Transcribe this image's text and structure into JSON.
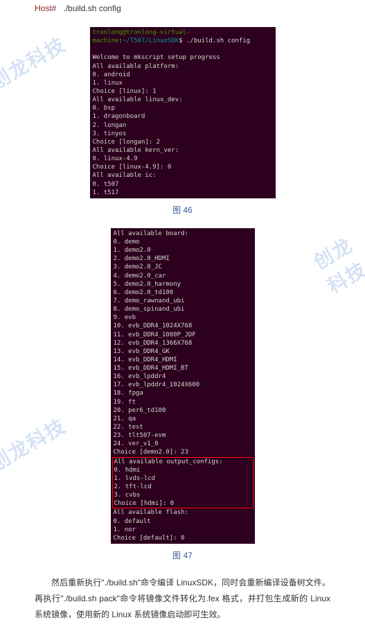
{
  "watermark": "创龙科技",
  "host": {
    "prompt": "Host#",
    "cmd": "./build.sh config"
  },
  "term1": {
    "prompt_user": "tronlong@tronlong-virtual-machine",
    "prompt_path": "~/T507/LinuxSDK",
    "prompt_cmd": "$ ./build.sh config",
    "l1": "Welcome to mkscript setup progress",
    "l2": "All available platform:",
    "l3": "   0. android",
    "l4": "   1. linux",
    "l5": "Choice [linux]: 1",
    "l6": "All available linux_dev:",
    "l7": "   0. bsp",
    "l8": "   1. dragonboard",
    "l9": "   2. longan",
    "l10": "   3. tinyos",
    "l11": "Choice [longan]: 2",
    "l12": "All available kern_ver:",
    "l13": "   0. linux-4.9",
    "l14": "Choice [linux-4.9]: 0",
    "l15": "All available ic:",
    "l16": "   0. t507",
    "l17": "   1. t517"
  },
  "cap1": "图 46",
  "term2": {
    "l1": "All available board:",
    "l2": "   0. demo",
    "l3": "   1. demo2.0",
    "l4": "   2. demo2.0_HDMI",
    "l5": "   3. demo2.0_JC",
    "l6": "   4. demo2.0_car",
    "l7": "   5. demo2.0_harmony",
    "l8": "   6. demo2.0_td100",
    "l9": "   7. demo_rawnand_ubi",
    "l10": "   8. demo_spinand_ubi",
    "l11": "   9. evb",
    "l12": "  10. evb_DDR4_1024X768",
    "l13": "  11. evb_DDR4_1080P_JDF",
    "l14": "  12. evb_DDR4_1366X768",
    "l15": "  13. evb_DDR4_GK",
    "l16": "  14. evb_DDR4_HDMI",
    "l17": "  15. evb_DDR4_HDMI_BT",
    "l18": "  16. evb_lpddr4",
    "l19": "  17. evb_lpddr4_1024X600",
    "l20": "  18. fpga",
    "l21": "  19. ft",
    "l22": "  20. per6_td100",
    "l23": "  21. qa",
    "l24": "  22. test",
    "l25": "  23. tlt507-evm",
    "l26": "  24. ver_v1_0",
    "l27": "Choice [demo2.0]: 23",
    "l28": "All available output_configs:",
    "l29": "   0. hdmi",
    "l30": "   1. lvds-lcd",
    "l31": "   2. tft-lcd",
    "l32": "   3. cvbs",
    "l33": "Choice [hdmi]: 0",
    "l34": "All available flash:",
    "l35": "   0. default",
    "l36": "   1. nor",
    "l37": "Choice [default]: 0"
  },
  "cap2": "图 47",
  "para": "然后重新执行\"./build.sh\"命令编译 LinuxSDK，同时会重新编译设备树文件。再执行\"./build.sh pack\"命令将镜像文件转化为.fex 格式，并打包生成新的 Linux 系统镜像，使用新的 Linux 系统镜像启动即可生效。"
}
